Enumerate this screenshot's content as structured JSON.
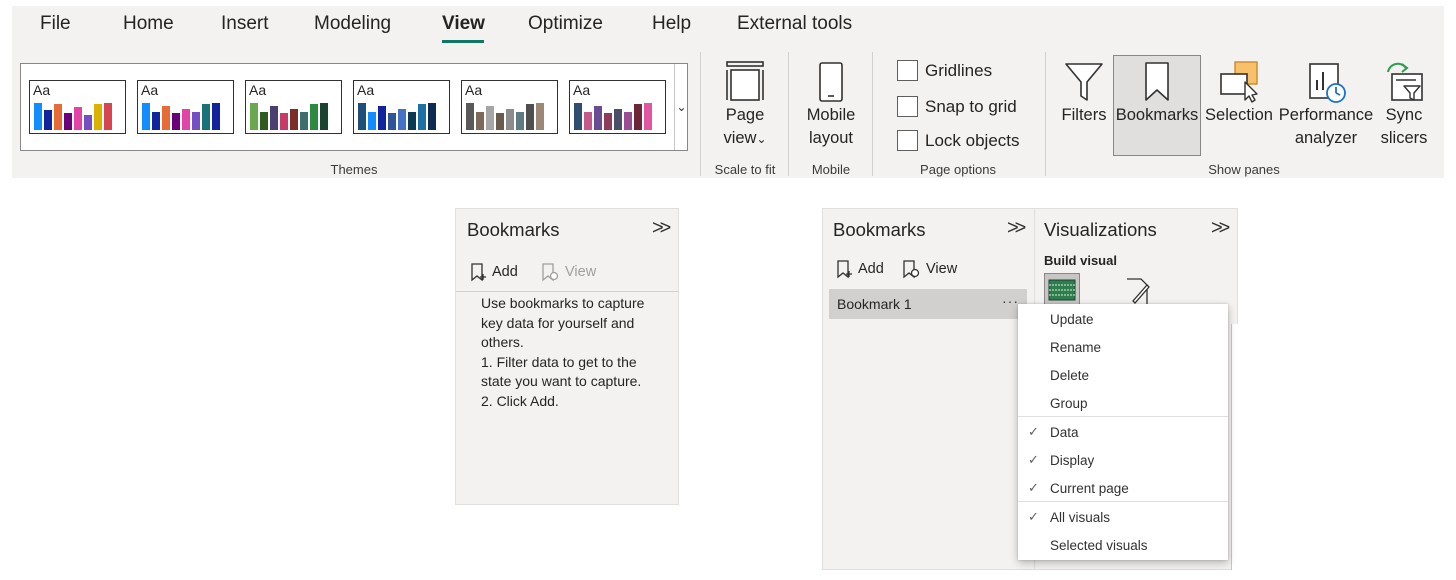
{
  "ribbon": {
    "tabs": [
      "File",
      "Home",
      "Insert",
      "Modeling",
      "View",
      "Optimize",
      "Help",
      "External tools"
    ],
    "active_tab": "View",
    "accent": "#117865",
    "groups": {
      "themes": "Themes",
      "scale": "Scale to fit",
      "mobile": "Mobile",
      "page_options": "Page options",
      "show_panes": "Show panes"
    },
    "theme_label": "Aa",
    "themes": [
      {
        "colors": [
          "#118dff",
          "#12239e",
          "#e66c37",
          "#6b007b",
          "#e044a7",
          "#744ec2",
          "#d9b300",
          "#d64550"
        ],
        "heights": [
          0.9,
          0.65,
          0.85,
          0.55,
          0.75,
          0.5,
          0.85,
          0.9
        ]
      },
      {
        "colors": [
          "#118dff",
          "#12239e",
          "#e66c37",
          "#6b007b",
          "#e044a7",
          "#744ec2",
          "#197278",
          "#12239e"
        ],
        "heights": [
          0.9,
          0.6,
          0.8,
          0.55,
          0.7,
          0.6,
          0.85,
          0.9
        ]
      },
      {
        "colors": [
          "#6aa84f",
          "#2e5e1f",
          "#4b3f72",
          "#c73b6a",
          "#7b2d26",
          "#3c6e71",
          "#2b8a3e",
          "#1b4332"
        ],
        "heights": [
          0.9,
          0.6,
          0.8,
          0.55,
          0.7,
          0.6,
          0.85,
          0.9
        ]
      },
      {
        "colors": [
          "#1f4e79",
          "#118dff",
          "#12239e",
          "#2f5597",
          "#4472c4",
          "#0b3954",
          "#1d6fa5",
          "#0d2c54"
        ],
        "heights": [
          0.9,
          0.6,
          0.8,
          0.55,
          0.7,
          0.6,
          0.85,
          0.9
        ]
      },
      {
        "colors": [
          "#595959",
          "#7f6a5a",
          "#a6a6a6",
          "#6b5b4f",
          "#8c8c8c",
          "#5e7a82",
          "#4f4f4f",
          "#9c8877"
        ],
        "heights": [
          0.9,
          0.6,
          0.8,
          0.55,
          0.7,
          0.6,
          0.85,
          0.9
        ]
      },
      {
        "colors": [
          "#2f4f6f",
          "#c45a8a",
          "#6a4c93",
          "#8e3b5c",
          "#4a4e69",
          "#9a4c95",
          "#6b2737",
          "#e056a0"
        ],
        "heights": [
          0.9,
          0.6,
          0.8,
          0.55,
          0.7,
          0.6,
          0.85,
          0.9
        ]
      }
    ],
    "page_view": [
      "Page",
      "view"
    ],
    "mobile_layout": [
      "Mobile",
      "layout"
    ],
    "page_options": [
      "Gridlines",
      "Snap to grid",
      "Lock objects"
    ],
    "filters": "Filters",
    "bookmarks": "Bookmarks",
    "selection": "Selection",
    "performance": [
      "Performance",
      "analyzer"
    ],
    "sync": [
      "Sync",
      "slicers"
    ]
  },
  "bookmarks_empty": {
    "title": "Bookmarks",
    "add": "Add",
    "view": "View",
    "help": [
      "Use bookmarks to capture",
      "key data for yourself and",
      "others.",
      "1. Filter data to get to the",
      "state you want to capture.",
      "2. Click Add."
    ]
  },
  "bookmarks_menu": {
    "title": "Bookmarks",
    "add": "Add",
    "view": "View",
    "item": "Bookmark 1",
    "viz_title": "Visualizations",
    "viz_sub": "Build visual",
    "menu": {
      "actions": [
        "Update",
        "Rename",
        "Delete",
        "Group"
      ],
      "capture": [
        "Data",
        "Display",
        "Current page"
      ],
      "scope": [
        "All visuals",
        "Selected visuals"
      ],
      "check": "✓"
    }
  }
}
